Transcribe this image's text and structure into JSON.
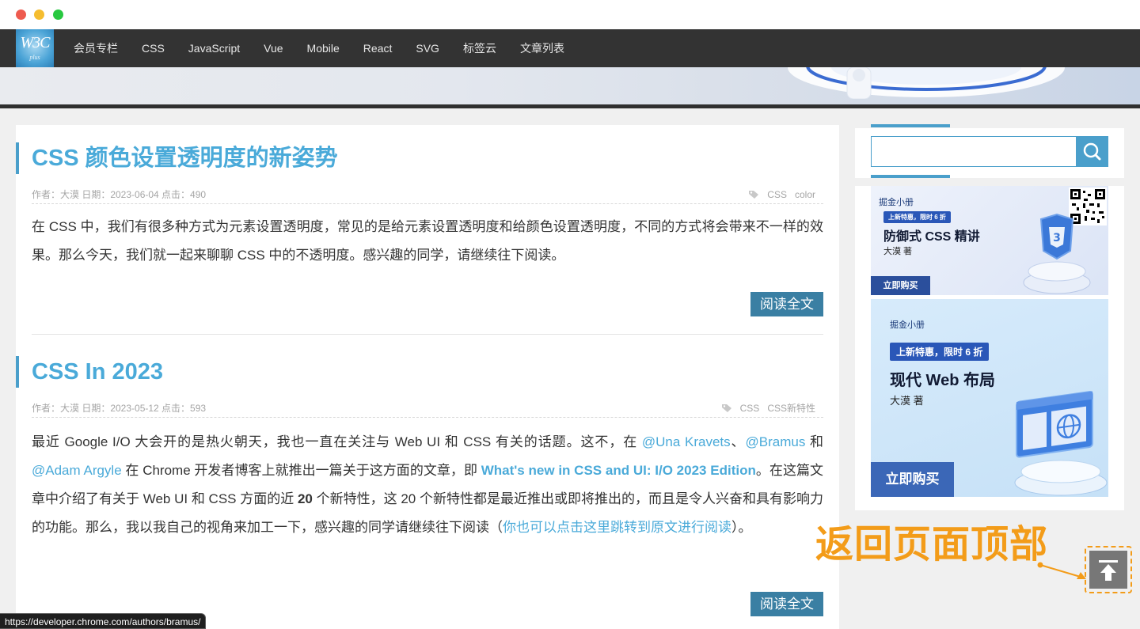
{
  "nav": {
    "logo_text": "W3C",
    "logo_sub": "plus",
    "items": [
      "会员专栏",
      "CSS",
      "JavaScript",
      "Vue",
      "Mobile",
      "React",
      "SVG",
      "标签云",
      "文章列表"
    ]
  },
  "articles": [
    {
      "title": "CSS 颜色设置透明度的新姿势",
      "meta": "作者：大漠 日期：2023-06-04 点击：490",
      "tags": [
        "CSS",
        "color"
      ],
      "excerpt": "在 CSS 中，我们有很多种方式为元素设置透明度，常见的是给元素设置透明度和给颜色设置透明度，不同的方式将会带来不一样的效果。那么今天，我们就一起来聊聊 CSS 中的不透明度。感兴趣的同学，请继续往下阅读。",
      "read_more": "阅读全文"
    },
    {
      "title": "CSS In 2023",
      "meta": "作者：大漠 日期：2023-05-12 点击：593",
      "tags": [
        "CSS",
        "CSS新特性"
      ],
      "excerpt_parts": {
        "p1": "最近 Google I/O 大会开的是热火朝天，我也一直在关注与 Web UI 和 CSS 有关的话题。这不，在 ",
        "link_una": "@Una Kravets",
        "sep": "、",
        "link_bramus": "@Bramus",
        "p2": " 和 ",
        "link_adam": "@Adam Argyle",
        "p3": " 在 Chrome 开发者博客上就推出一篇关于这方面的文章，即 ",
        "link_whatsnew": "What's new in CSS and UI: I/O 2023 Edition",
        "p4": "。在这篇文章中介绍了有关于 Web UI 和 CSS 方面的近 ",
        "num": "20",
        "p5": " 个新特性，这 20 个新特性都是最近推出或即将推出的，而且是令人兴奋和具有影响力的功能。那么，我以我自己的视角来加工一下，感兴趣的同学请继续往下阅读（",
        "link_original": "你也可以点击这里跳转到原文进行阅读",
        "p6": "）。"
      },
      "read_more": "阅读全文"
    }
  ],
  "sidebar": {
    "search_placeholder": "",
    "ad1": {
      "brand": "掘金小册",
      "pill": "上新特惠，限时 6 折",
      "title": "防御式 CSS 精讲",
      "author": "大漠 著",
      "button": "立即购买"
    },
    "ad2": {
      "brand": "掘金小册",
      "pill": "上新特惠，限时 6 折",
      "title": "现代 Web 布局",
      "author": "大漠 著",
      "button": "立即购买"
    }
  },
  "annotation": {
    "text": "返回页面顶部"
  },
  "status_url": "https://developer.chrome.com/authors/bramus/",
  "colors": {
    "accent": "#4aaad9",
    "button": "#3a7fa3",
    "annotation": "#f39c19",
    "nav_bg": "#333333"
  }
}
